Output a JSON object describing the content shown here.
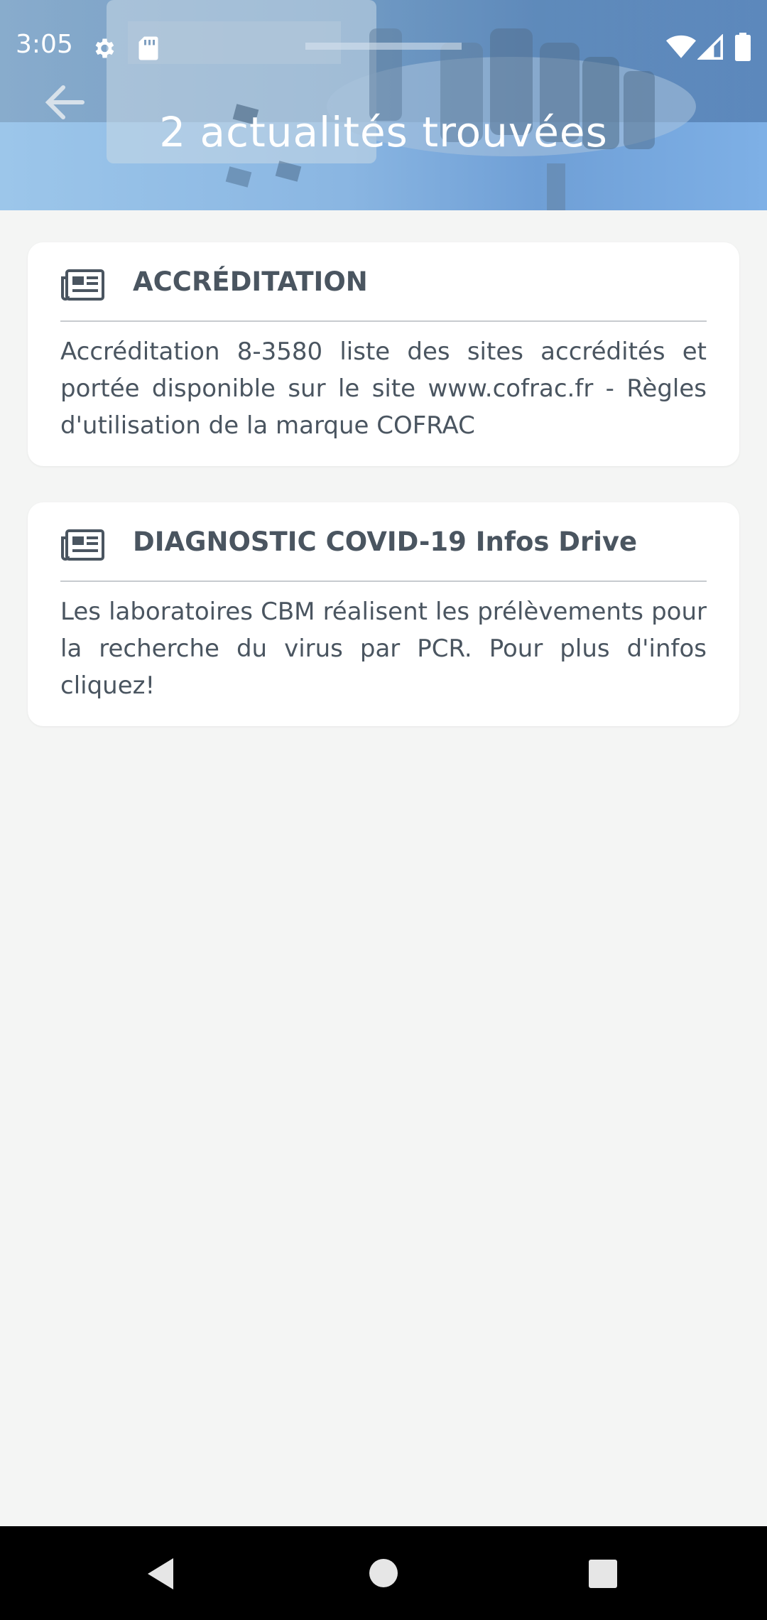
{
  "status_bar": {
    "time": "3:05",
    "icons": [
      "settings-gear-icon",
      "sd-card-icon",
      "wifi-icon",
      "cellular-signal-icon",
      "battery-icon"
    ]
  },
  "header": {
    "title": "2 actualités trouvées",
    "back_icon": "arrow-back-icon"
  },
  "news": [
    {
      "icon": "newspaper-icon",
      "title": "ACCRÉDITATION",
      "text": "Accréditation 8-3580 liste des sites accrédités et portée disponible sur le site www.cofrac.fr - Règles d'utilisation de la marque COFRAC"
    },
    {
      "icon": "newspaper-icon",
      "title": "DIAGNOSTIC COVID-19 Infos Drive",
      "text": " Les laboratoires CBM réalisent les prélèvements pour la recherche du virus par PCR.  Pour plus d'infos cliquez!"
    }
  ],
  "navigation_bar": {
    "buttons": [
      "back-triangle-icon",
      "home-circle-icon",
      "recents-square-icon"
    ]
  },
  "colors": {
    "background": "#f4f5f4",
    "card": "#ffffff",
    "text": "#4a5560",
    "header_blue": "#8ab6e2"
  }
}
